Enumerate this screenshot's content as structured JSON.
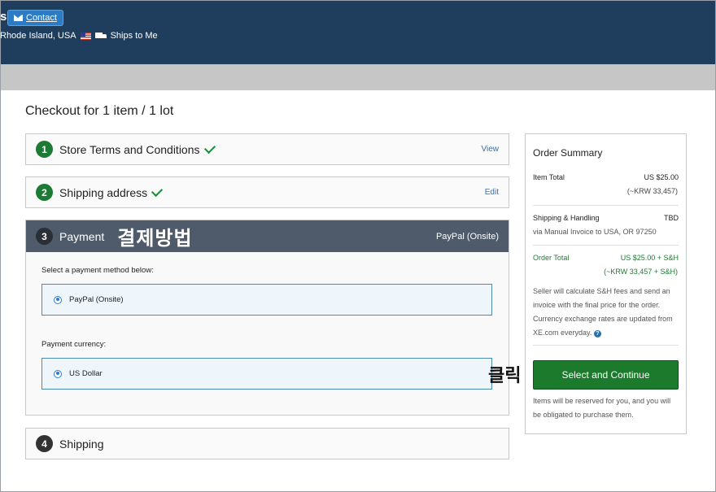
{
  "header": {
    "title_fragment": "s",
    "contact_label": "Contact",
    "location": "Rhode Island, USA",
    "ships_label": "Ships to Me"
  },
  "checkout": {
    "title": "Checkout for 1 item / 1 lot",
    "steps": [
      {
        "num": "1",
        "label": "Store Terms and Conditions",
        "link": "View"
      },
      {
        "num": "2",
        "label": "Shipping address",
        "link": "Edit"
      },
      {
        "num": "3",
        "label": "Payment",
        "selected": "PayPal (Onsite)"
      },
      {
        "num": "4",
        "label": "Shipping"
      }
    ],
    "payment": {
      "method_prompt": "Select a payment method below:",
      "method_option": "PayPal (Onsite)",
      "currency_prompt": "Payment currency:",
      "currency_option": "US Dollar"
    }
  },
  "summary": {
    "title": "Order Summary",
    "item_total_label": "Item Total",
    "item_total_value": "US $25.00",
    "item_total_krw": "(~KRW 33,457)",
    "shipping_label": "Shipping & Handling",
    "shipping_value": "TBD",
    "shipping_via": "via Manual Invoice to USA, OR 97250",
    "order_total_label": "Order Total",
    "order_total_value": "US $25.00 + S&H",
    "order_total_krw": "(~KRW 33,457 + S&H)",
    "note": "Seller will calculate S&H fees and send an invoice with the final price for the order. Currency exchange rates are updated from XE.com everyday.",
    "help_glyph": "?",
    "continue_label": "Select and Continue",
    "reserve_note": "Items will be reserved for you, and you will be obligated to purchase them."
  },
  "annotations": {
    "payment_note": "결제방법",
    "click_note": "클릭"
  },
  "colors": {
    "header_bg": "#1f3e5e",
    "step_done": "#1c7a34",
    "payment_head": "#4f5b6b",
    "continue_btn": "#1c7a2c"
  }
}
